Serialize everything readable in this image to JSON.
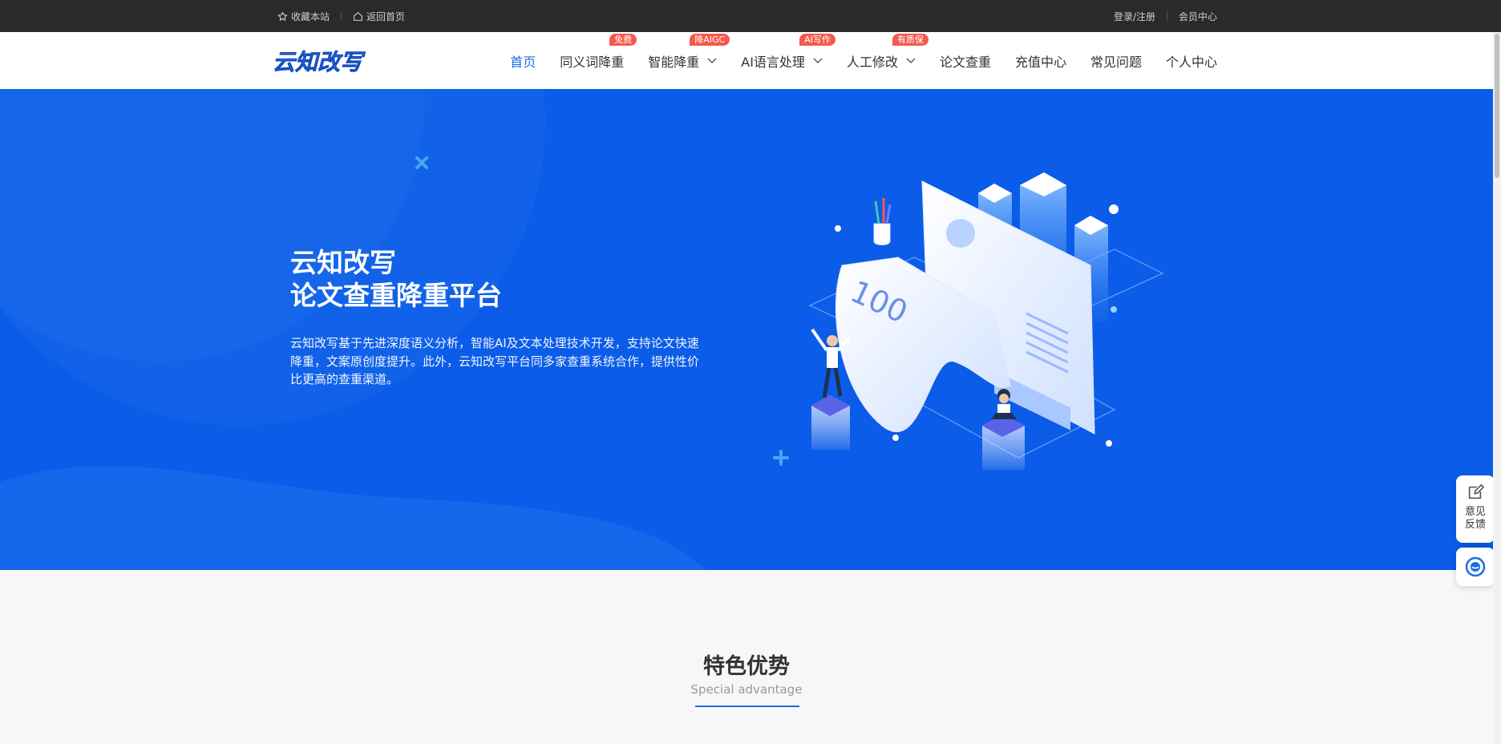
{
  "topbar": {
    "bookmark_label": "收藏本站",
    "home_label": "返回首页",
    "login_label": "登录/注册",
    "member_label": "会员中心"
  },
  "logo": {
    "text": "云知改写"
  },
  "nav": {
    "items": [
      {
        "label": "首页",
        "active": true
      },
      {
        "label": "同义词降重",
        "badge": "免费"
      },
      {
        "label": "智能降重",
        "badge": "降AIGC",
        "dropdown": true
      },
      {
        "label": "AI语言处理",
        "badge": "AI写作",
        "dropdown": true
      },
      {
        "label": "人工修改",
        "badge": "有质保",
        "dropdown": true
      },
      {
        "label": "论文查重"
      },
      {
        "label": "充值中心"
      },
      {
        "label": "常见问题"
      },
      {
        "label": "个人中心"
      }
    ]
  },
  "hero": {
    "title_line1": "云知改写",
    "title_line2": "论文查重降重平台",
    "description": "云知改写基于先进深度语义分析，智能AI及文本处理技术开发，支持论文快速降重，文案原创度提升。此外，云知改写平台同多家查重系统合作，提供性价比更高的查重渠道。",
    "illustration_number": "100"
  },
  "side": {
    "feedback_label": "意见反馈",
    "feedback_icon": "edit-icon",
    "service_icon": "customer-service-icon"
  },
  "section": {
    "title": "特色优势",
    "subtitle": "Special advantage"
  },
  "colors": {
    "primary": "#1c6ce8",
    "hero_bg": "#0b5ce8",
    "badge": "#f4594d",
    "topbar_bg": "#2a2a2a"
  }
}
